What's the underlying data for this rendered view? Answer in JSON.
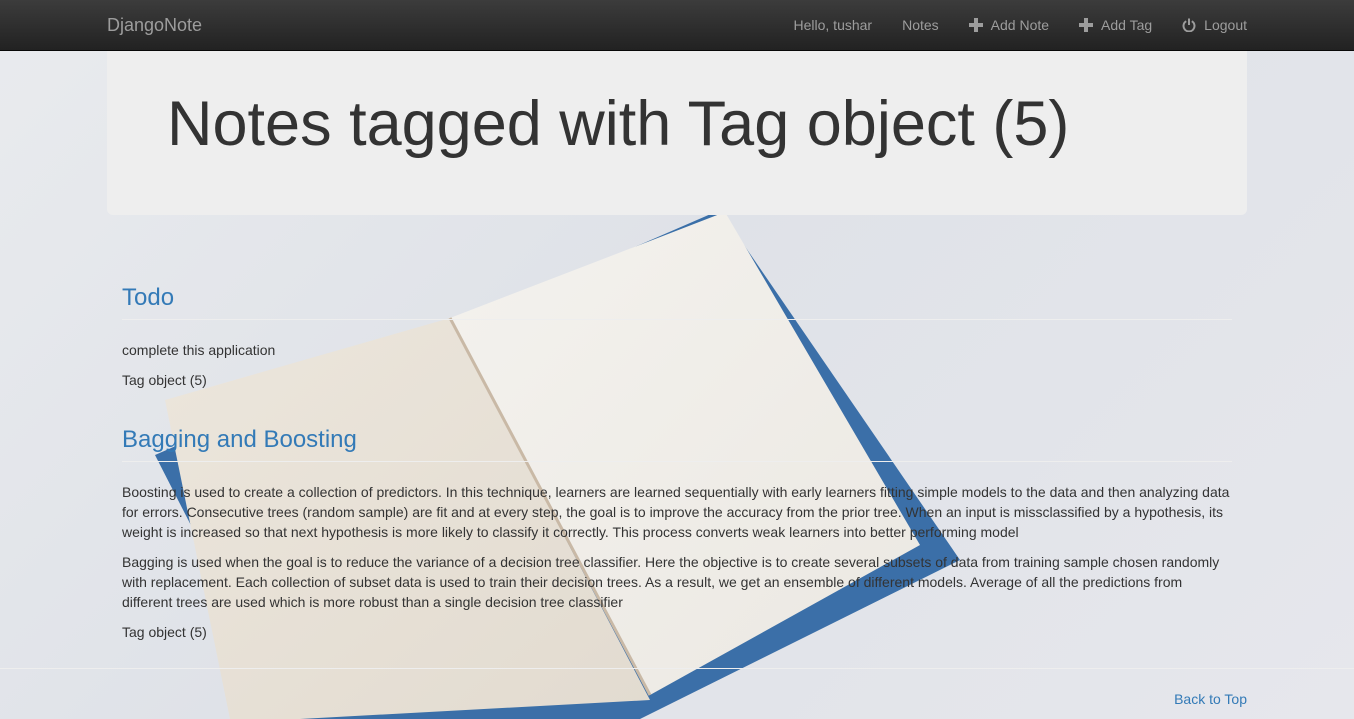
{
  "navbar": {
    "brand": "DjangoNote",
    "greeting": "Hello, tushar",
    "notes_label": "Notes",
    "add_note_label": "Add Note",
    "add_tag_label": "Add Tag",
    "logout_label": "Logout"
  },
  "page": {
    "title": "Notes tagged with Tag object (5)"
  },
  "notes": [
    {
      "title": "Todo",
      "paragraphs": [
        "complete this application"
      ],
      "tag": "Tag object (5)"
    },
    {
      "title": "Bagging and Boosting",
      "paragraphs": [
        "Boosting is used to create a collection of predictors. In this technique, learners are learned sequentially with early learners fitting simple models to the data and then analyzing data for errors. Consecutive trees (random sample) are fit and at every step, the goal is to improve the accuracy from the prior tree. When an input is missclassified by a hypothesis, its weight is increased so that next hypothesis is more likely to classify it correctly. This process converts weak learners into better performing model",
        "Bagging is used when the goal is to reduce the variance of a decision tree classifier. Here the objective is to create several subsets of data from training sample chosen randomly with replacement. Each collection of subset data is used to train their decision trees. As a result, we get an ensemble of different models. Average of all the predictions from different trees are used which is more robust than a single decision tree classifier"
      ],
      "tag": "Tag object (5)"
    }
  ],
  "footer": {
    "back_to_top": "Back to Top"
  },
  "icons": {
    "add_note": "plus-icon",
    "add_tag": "plus-icon",
    "logout": "power-icon"
  },
  "colors": {
    "link": "#337ab7",
    "navbar": "#222222",
    "jumbotron": "#eeeeee"
  }
}
